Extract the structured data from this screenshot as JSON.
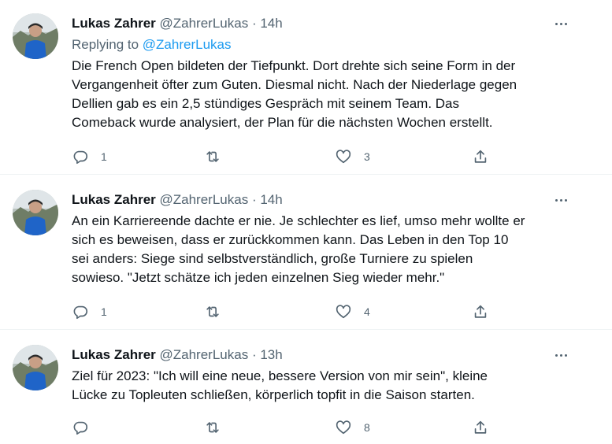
{
  "tweets": [
    {
      "author_name": "Lukas Zahrer",
      "handle": "@ZahrerLukas",
      "separator": "·",
      "time": "14h",
      "replying_prefix": "Replying to ",
      "replying_handle": "@ZahrerLukas",
      "text": "Die French Open bildeten der Tiefpunkt. Dort drehte sich seine Form in der\nVergangenheit öfter zum Guten. Diesmal nicht. Nach der Niederlage gegen\nDellien gab es ein 2,5 stündiges Gespräch mit seinem Team. Das\nComeback wurde analysiert, der Plan für die nächsten Wochen erstellt.",
      "reply_count": "1",
      "retweet_count": "",
      "like_count": "3"
    },
    {
      "author_name": "Lukas Zahrer",
      "handle": "@ZahrerLukas",
      "separator": "·",
      "time": "14h",
      "text": "An ein Karriereende dachte er nie. Je schlechter es lief, umso mehr wollte er\nsich es beweisen, dass er zurückkommen kann. Das Leben in den Top 10\nsei anders: Siege sind selbstverständlich, große Turniere zu spielen\nsowieso. \"Jetzt schätze ich jeden einzelnen Sieg wieder mehr.\"",
      "reply_count": "1",
      "retweet_count": "",
      "like_count": "4"
    },
    {
      "author_name": "Lukas Zahrer",
      "handle": "@ZahrerLukas",
      "separator": "·",
      "time": "13h",
      "text": "Ziel für 2023: \"Ich will eine neue, bessere Version von mir sein\", kleine\nLücke zu Topleuten schließen, körperlich topfit in die Saison starten.",
      "reply_count": "",
      "retweet_count": "",
      "like_count": "8"
    }
  ],
  "icons": {
    "reply": "reply-icon",
    "retweet": "retweet-icon",
    "like": "heart-icon",
    "share": "share-icon",
    "more": "more-icon"
  },
  "colors": {
    "text": "#0f1419",
    "secondary": "#536471",
    "link": "#1d9bf0",
    "divider": "#eff3f4"
  }
}
